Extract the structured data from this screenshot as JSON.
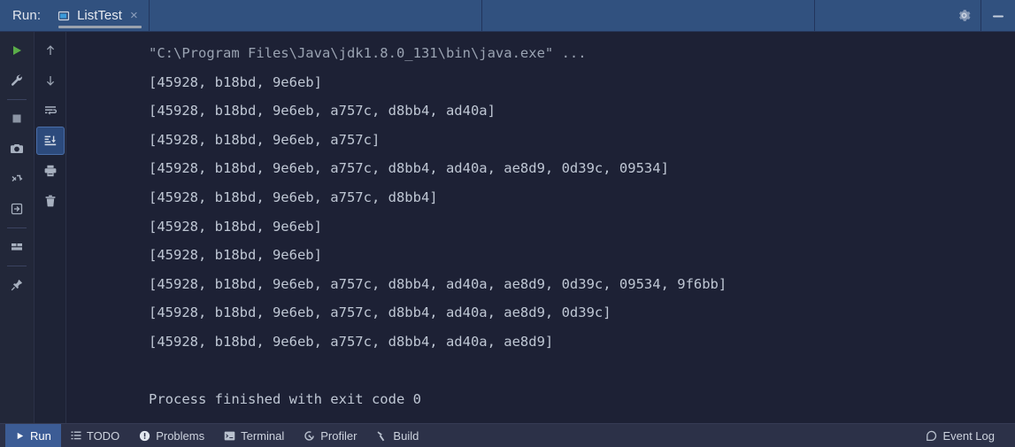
{
  "header": {
    "run_label": "Run:",
    "tab": {
      "title": "ListTest",
      "icon": "run-configuration-icon",
      "close_label": "×"
    },
    "settings_icon": "gear-icon",
    "minimize_icon": "minimize-icon"
  },
  "toolbar_primary": {
    "items": [
      {
        "name": "rerun-button",
        "icon": "play-icon",
        "tooltip": "Rerun"
      },
      {
        "name": "edit-configuration-button",
        "icon": "wrench-icon",
        "tooltip": "Edit Configuration"
      },
      {
        "name": "stop-button",
        "icon": "stop-icon",
        "tooltip": "Stop"
      },
      {
        "name": "dump-threads-button",
        "icon": "camera-icon",
        "tooltip": "Dump Threads"
      },
      {
        "name": "restart-button",
        "icon": "restart-icon",
        "tooltip": "Restart"
      },
      {
        "name": "attach-button",
        "icon": "attach-icon",
        "tooltip": "Attach"
      },
      {
        "name": "layout-button",
        "icon": "layout-icon",
        "tooltip": "Layout Settings"
      },
      {
        "name": "pin-tab-button",
        "icon": "pin-icon",
        "tooltip": "Pin Tab"
      }
    ]
  },
  "toolbar_secondary": {
    "items": [
      {
        "name": "up-button",
        "icon": "arrow-up-icon",
        "tooltip": "Up the Stack Trace",
        "active": false
      },
      {
        "name": "down-button",
        "icon": "arrow-down-icon",
        "tooltip": "Down the Stack Trace",
        "active": false
      },
      {
        "name": "soft-wrap-button",
        "icon": "soft-wrap-icon",
        "tooltip": "Use Soft Wraps",
        "active": false
      },
      {
        "name": "scroll-to-end-button",
        "icon": "scroll-to-end-icon",
        "tooltip": "Scroll to the end",
        "active": true
      },
      {
        "name": "print-button",
        "icon": "print-icon",
        "tooltip": "Print",
        "active": false
      },
      {
        "name": "clear-all-button",
        "icon": "trash-icon",
        "tooltip": "Clear All",
        "active": false
      }
    ]
  },
  "console": {
    "lines": [
      {
        "text": "\"C:\\Program Files\\Java\\jdk1.8.0_131\\bin\\java.exe\" ...",
        "kind": "cmd"
      },
      {
        "text": "[45928, b18bd, 9e6eb]",
        "kind": "out"
      },
      {
        "text": "[45928, b18bd, 9e6eb, a757c, d8bb4, ad40a]",
        "kind": "out"
      },
      {
        "text": "[45928, b18bd, 9e6eb, a757c]",
        "kind": "out"
      },
      {
        "text": "[45928, b18bd, 9e6eb, a757c, d8bb4, ad40a, ae8d9, 0d39c, 09534]",
        "kind": "out"
      },
      {
        "text": "[45928, b18bd, 9e6eb, a757c, d8bb4]",
        "kind": "out"
      },
      {
        "text": "[45928, b18bd, 9e6eb]",
        "kind": "out"
      },
      {
        "text": "[45928, b18bd, 9e6eb]",
        "kind": "out"
      },
      {
        "text": "[45928, b18bd, 9e6eb, a757c, d8bb4, ad40a, ae8d9, 0d39c, 09534, 9f6bb]",
        "kind": "out"
      },
      {
        "text": "[45928, b18bd, 9e6eb, a757c, d8bb4, ad40a, ae8d9, 0d39c]",
        "kind": "out"
      },
      {
        "text": "[45928, b18bd, 9e6eb, a757c, d8bb4, ad40a, ae8d9]",
        "kind": "out"
      },
      {
        "text": " ",
        "kind": "blank"
      },
      {
        "text": "Process finished with exit code 0",
        "kind": "out"
      }
    ]
  },
  "statusbar": {
    "items": [
      {
        "name": "status-run",
        "label": "Run",
        "icon": "play-small-icon",
        "selected": true
      },
      {
        "name": "status-todo",
        "label": "TODO",
        "icon": "todo-icon",
        "selected": false
      },
      {
        "name": "status-problems",
        "label": "Problems",
        "icon": "problems-icon",
        "selected": false
      },
      {
        "name": "status-terminal",
        "label": "Terminal",
        "icon": "terminal-icon",
        "selected": false
      },
      {
        "name": "status-profiler",
        "label": "Profiler",
        "icon": "profiler-icon",
        "selected": false
      },
      {
        "name": "status-build",
        "label": "Build",
        "icon": "build-hammer-icon",
        "selected": false
      }
    ],
    "event_log": {
      "label": "Event Log",
      "icon": "event-log-icon"
    }
  },
  "colors": {
    "header_bg": "#31517f",
    "console_bg": "#1d2135",
    "toolbar_bg": "#222739",
    "statusbar_bg": "#2c3148",
    "accent_selected": "#3c5c95",
    "text": "#bfc7d4",
    "run_green": "#5aad49"
  }
}
